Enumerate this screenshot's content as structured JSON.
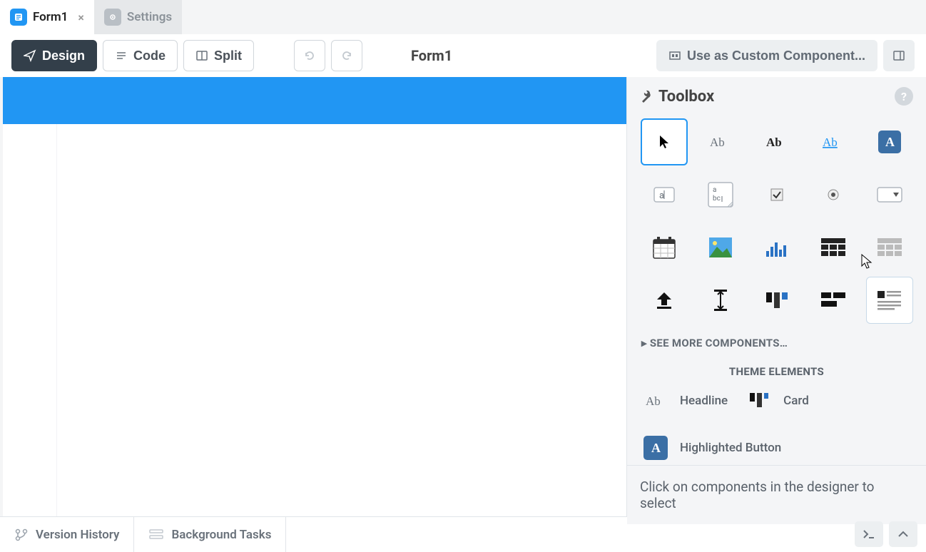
{
  "tabs": [
    {
      "label": "Form1",
      "active": true,
      "closable": true
    },
    {
      "label": "Settings",
      "active": false,
      "closable": false
    }
  ],
  "toolbar": {
    "design_label": "Design",
    "code_label": "Code",
    "split_label": "Split",
    "title": "Form1",
    "custom_component_label": "Use as Custom Component..."
  },
  "toolbox": {
    "title": "Toolbox",
    "see_more_label": "SEE MORE COMPONENTS…",
    "theme_section_title": "THEME ELEMENTS",
    "theme_items": [
      {
        "label": "Headline"
      },
      {
        "label": "Card"
      },
      {
        "label": "Highlighted Button"
      }
    ],
    "hint": "Click on components in the designer to select"
  },
  "statusbar": {
    "version_history_label": "Version History",
    "background_tasks_label": "Background Tasks"
  }
}
